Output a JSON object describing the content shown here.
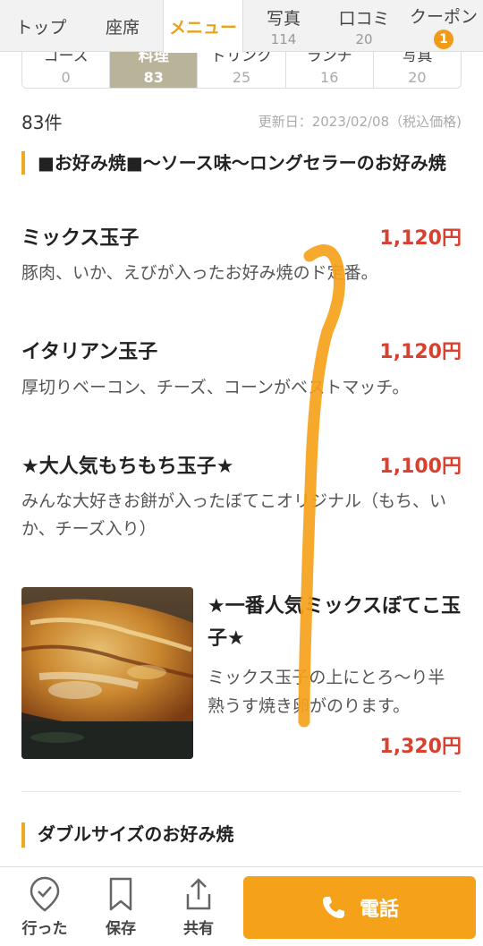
{
  "topnav": {
    "tabs": [
      {
        "label": "トップ"
      },
      {
        "label": "座席"
      },
      {
        "label": "メニュー"
      },
      {
        "label": "写真",
        "count": "114"
      },
      {
        "label": "口コミ",
        "count": "20"
      },
      {
        "label": "クーポン",
        "badge": "1"
      }
    ]
  },
  "subtabs": [
    {
      "label": "コース",
      "count": "0"
    },
    {
      "label": "料理",
      "count": "83"
    },
    {
      "label": "ドリンク",
      "count": "25"
    },
    {
      "label": "ランチ",
      "count": "16"
    },
    {
      "label": "写真",
      "count": "20"
    }
  ],
  "meta": {
    "count": "83件",
    "updated": "更新日：2023/02/08（税込価格)"
  },
  "sections": [
    {
      "title": "■お好み焼■〜ソース味〜ロングセラーのお好み焼"
    },
    {
      "title": "ダブルサイズのお好み焼"
    }
  ],
  "items": [
    {
      "name": "ミックス玉子",
      "price": "1,120円",
      "desc": "豚肉、いか、えびが入ったお好み焼のド定番。"
    },
    {
      "name": "イタリアン玉子",
      "price": "1,120円",
      "desc": "厚切りベーコン、チーズ、コーンがベストマッチ。"
    },
    {
      "name": "★大人気もちもち玉子★",
      "price": "1,100円",
      "desc": "みんな大好きお餅が入ったぼてこオリジナル（もち、いか、チーズ入り）"
    },
    {
      "name": "★一番人気ミックスぼてこ玉子★",
      "price": "1,320円",
      "desc": "ミックス玉子の上にとろ〜り半熟うす焼き卵がのります。"
    }
  ],
  "bottombar": {
    "visited": "行った",
    "save": "保存",
    "share": "共有",
    "call": "電話"
  },
  "colors": {
    "accent": "#f5a21a",
    "price": "#d9402f",
    "active_subtab": "#b9b39a"
  }
}
